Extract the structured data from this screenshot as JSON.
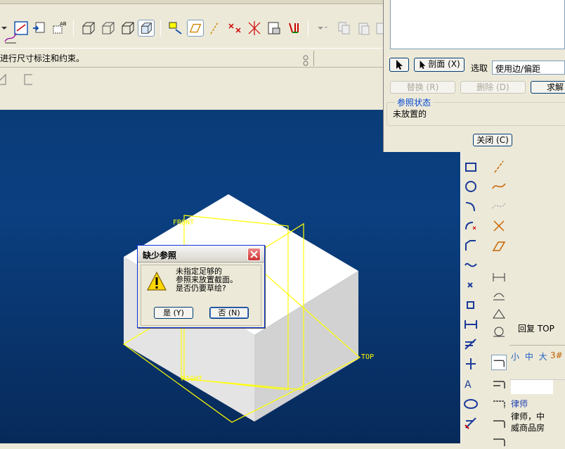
{
  "status_message": "进行尺寸标注和约束。",
  "ref_panel": {
    "select_button": "",
    "section_button": "剖面 (X)",
    "select_label": "选取",
    "select_value": "使用边/偏距",
    "replace_button": "替换 (R)",
    "delete_button": "删除 (D)",
    "solve_button": "求解",
    "group_title": "参照状态",
    "status_value": "未放置的",
    "close_button": "关闭 (C)"
  },
  "viewport": {
    "labels": [
      "FRONT",
      "TOP",
      "RIGHT"
    ]
  },
  "info_panel": {
    "reply_text": "回复 TOP",
    "font_sizes": "小 中 大",
    "number_mark": "3#",
    "ad_title": "律师",
    "ad_line1": "律师，中",
    "ad_line2": "威商品房"
  },
  "dialog": {
    "title": "缺少参照",
    "message_line1": "未指定足够的",
    "message_line2": "参照来放置截面。",
    "message_line3": "是否仍要草绘?",
    "yes_button": "是 (Y)",
    "no_button": "否 (N)"
  },
  "colors": {
    "viewport_blue": "#0a3c78",
    "wireframe_yellow": "#ffff00",
    "dialog_border": "#0831d9"
  }
}
